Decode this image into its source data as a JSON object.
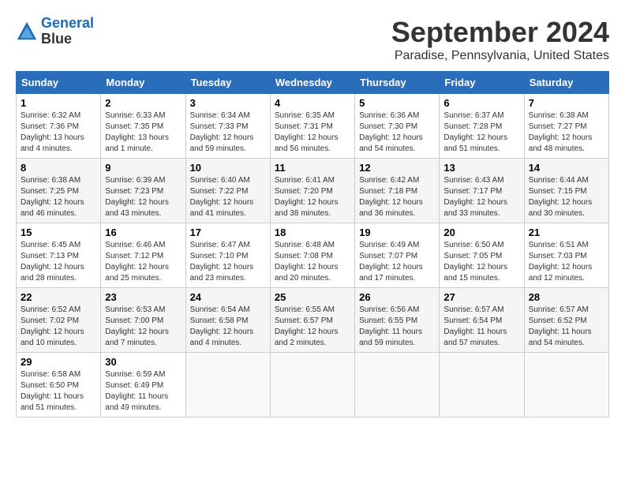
{
  "header": {
    "logo_line1": "General",
    "logo_line2": "Blue",
    "month": "September 2024",
    "location": "Paradise, Pennsylvania, United States"
  },
  "weekdays": [
    "Sunday",
    "Monday",
    "Tuesday",
    "Wednesday",
    "Thursday",
    "Friday",
    "Saturday"
  ],
  "weeks": [
    [
      {
        "day": "1",
        "sunrise": "6:32 AM",
        "sunset": "7:36 PM",
        "daylight": "13 hours and 4 minutes"
      },
      {
        "day": "2",
        "sunrise": "6:33 AM",
        "sunset": "7:35 PM",
        "daylight": "13 hours and 1 minute"
      },
      {
        "day": "3",
        "sunrise": "6:34 AM",
        "sunset": "7:33 PM",
        "daylight": "12 hours and 59 minutes"
      },
      {
        "day": "4",
        "sunrise": "6:35 AM",
        "sunset": "7:31 PM",
        "daylight": "12 hours and 56 minutes"
      },
      {
        "day": "5",
        "sunrise": "6:36 AM",
        "sunset": "7:30 PM",
        "daylight": "12 hours and 54 minutes"
      },
      {
        "day": "6",
        "sunrise": "6:37 AM",
        "sunset": "7:28 PM",
        "daylight": "12 hours and 51 minutes"
      },
      {
        "day": "7",
        "sunrise": "6:38 AM",
        "sunset": "7:27 PM",
        "daylight": "12 hours and 48 minutes"
      }
    ],
    [
      {
        "day": "8",
        "sunrise": "6:38 AM",
        "sunset": "7:25 PM",
        "daylight": "12 hours and 46 minutes"
      },
      {
        "day": "9",
        "sunrise": "6:39 AM",
        "sunset": "7:23 PM",
        "daylight": "12 hours and 43 minutes"
      },
      {
        "day": "10",
        "sunrise": "6:40 AM",
        "sunset": "7:22 PM",
        "daylight": "12 hours and 41 minutes"
      },
      {
        "day": "11",
        "sunrise": "6:41 AM",
        "sunset": "7:20 PM",
        "daylight": "12 hours and 38 minutes"
      },
      {
        "day": "12",
        "sunrise": "6:42 AM",
        "sunset": "7:18 PM",
        "daylight": "12 hours and 36 minutes"
      },
      {
        "day": "13",
        "sunrise": "6:43 AM",
        "sunset": "7:17 PM",
        "daylight": "12 hours and 33 minutes"
      },
      {
        "day": "14",
        "sunrise": "6:44 AM",
        "sunset": "7:15 PM",
        "daylight": "12 hours and 30 minutes"
      }
    ],
    [
      {
        "day": "15",
        "sunrise": "6:45 AM",
        "sunset": "7:13 PM",
        "daylight": "12 hours and 28 minutes"
      },
      {
        "day": "16",
        "sunrise": "6:46 AM",
        "sunset": "7:12 PM",
        "daylight": "12 hours and 25 minutes"
      },
      {
        "day": "17",
        "sunrise": "6:47 AM",
        "sunset": "7:10 PM",
        "daylight": "12 hours and 23 minutes"
      },
      {
        "day": "18",
        "sunrise": "6:48 AM",
        "sunset": "7:08 PM",
        "daylight": "12 hours and 20 minutes"
      },
      {
        "day": "19",
        "sunrise": "6:49 AM",
        "sunset": "7:07 PM",
        "daylight": "12 hours and 17 minutes"
      },
      {
        "day": "20",
        "sunrise": "6:50 AM",
        "sunset": "7:05 PM",
        "daylight": "12 hours and 15 minutes"
      },
      {
        "day": "21",
        "sunrise": "6:51 AM",
        "sunset": "7:03 PM",
        "daylight": "12 hours and 12 minutes"
      }
    ],
    [
      {
        "day": "22",
        "sunrise": "6:52 AM",
        "sunset": "7:02 PM",
        "daylight": "12 hours and 10 minutes"
      },
      {
        "day": "23",
        "sunrise": "6:53 AM",
        "sunset": "7:00 PM",
        "daylight": "12 hours and 7 minutes"
      },
      {
        "day": "24",
        "sunrise": "6:54 AM",
        "sunset": "6:58 PM",
        "daylight": "12 hours and 4 minutes"
      },
      {
        "day": "25",
        "sunrise": "6:55 AM",
        "sunset": "6:57 PM",
        "daylight": "12 hours and 2 minutes"
      },
      {
        "day": "26",
        "sunrise": "6:56 AM",
        "sunset": "6:55 PM",
        "daylight": "11 hours and 59 minutes"
      },
      {
        "day": "27",
        "sunrise": "6:57 AM",
        "sunset": "6:54 PM",
        "daylight": "11 hours and 57 minutes"
      },
      {
        "day": "28",
        "sunrise": "6:57 AM",
        "sunset": "6:52 PM",
        "daylight": "11 hours and 54 minutes"
      }
    ],
    [
      {
        "day": "29",
        "sunrise": "6:58 AM",
        "sunset": "6:50 PM",
        "daylight": "11 hours and 51 minutes"
      },
      {
        "day": "30",
        "sunrise": "6:59 AM",
        "sunset": "6:49 PM",
        "daylight": "11 hours and 49 minutes"
      },
      null,
      null,
      null,
      null,
      null
    ]
  ]
}
